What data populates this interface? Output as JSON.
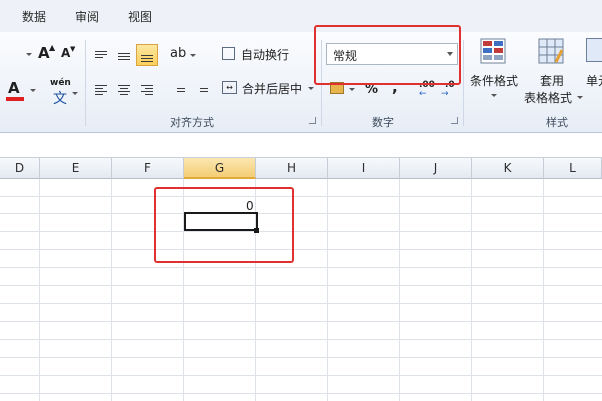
{
  "tabs": [
    "数据",
    "审阅",
    "视图"
  ],
  "alignment": {
    "group_label": "对齐方式",
    "wrap_text": "自动换行",
    "merge_center": "合并后居中"
  },
  "font": {
    "grow_glyph": "A",
    "shrink_glyph": "A",
    "font_color_glyph": "A",
    "wen_top": "wén",
    "wen_bottom": "文"
  },
  "number": {
    "group_label": "数字",
    "format_value": "常规",
    "percent": "%",
    "comma": ",",
    "inc_decimal": ".00\n→.0",
    "inc_decimal_a": ".00",
    "dec_decimal_a": ".0"
  },
  "styles": {
    "group_label": "样式",
    "conditional_format": "条件格式",
    "table_format_line1": "套用",
    "table_format_line2": "表格格式",
    "cell_styles": "单元"
  },
  "columns": [
    "D",
    "E",
    "F",
    "G",
    "H",
    "I",
    "J",
    "K",
    "L"
  ],
  "selected_column": "G",
  "cell_value": "0",
  "colors": {
    "highlight": "#e03131",
    "selected_column": "#f3cd74",
    "font_color_bar": "#e02020"
  }
}
